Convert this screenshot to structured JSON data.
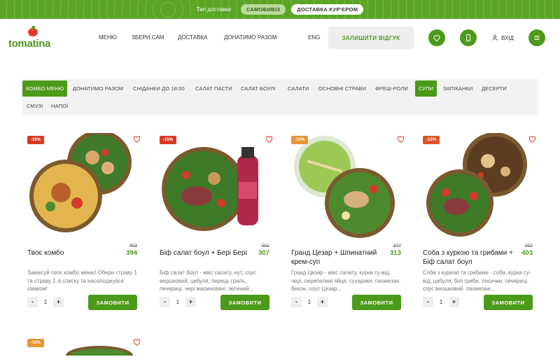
{
  "topbar": {
    "label": "Тип доставки:",
    "options": [
      "САМОВИВІЗ",
      "ДОСТАВКА КУР'ЄРОМ"
    ]
  },
  "logo": {
    "text": "tomatina"
  },
  "nav": {
    "items": [
      "МЕНЮ",
      "ЗБЕРИ САМ",
      "ДОСТАВКА",
      "ДОНАТИМО РАЗОМ"
    ],
    "lang": "ENG",
    "review": "ЗАЛИШИТИ ВІДГУК",
    "login": "ВХІД"
  },
  "categories": [
    "КОМБО МЕНЮ",
    "ДОНАТИМО РАЗОМ",
    "СНІДАНКИ ДО 18:00",
    "САЛАТ ПАСТИ",
    "САЛАТ БОУЛІ",
    "САЛАТИ",
    "ОСНОВНІ СТРАВИ",
    "ФРЕШ-РОЛИ",
    "СУПИ",
    "ЗАПІКАНКИ",
    "ДЕСЕРТИ",
    "СМУЗІ",
    "НАПОЇ"
  ],
  "selected_categories": [
    "КОМБО МЕНЮ",
    "СУПИ"
  ],
  "products": [
    {
      "discount": "-15%",
      "name": "Твоє комбо",
      "old_price": "463",
      "price": "394",
      "desc": "Заміксуй своє комбо меню! Обери страву 1 та страву 2 зі списку та насолоджуйся смаком!",
      "qty": "1"
    },
    {
      "discount": "-15%",
      "name": "Біф салат боул + Бері Бері",
      "old_price": "361",
      "price": "307",
      "desc": "Біф салат боул - мікс салату, нут, соус вершковий, цибуля, перець гриль, печериці. чері маоиновані. зелений...",
      "qty": "1"
    },
    {
      "discount": "-10%",
      "name": "Гранд Цезар + Шпинатний крем-суп",
      "old_price": "347",
      "price": "313",
      "desc": "Гранд Цезар - мікс салату, курка су-від, чері, перепелині яйця, сухарики, пaомезан. бекон. соус Цезар...",
      "qty": "1"
    },
    {
      "discount": "-12%",
      "name": "Соба з куркою та грибами + Біф салат боул",
      "old_price": "462",
      "price": "403",
      "desc": "Соба з куркою та грибами - соба, курка су-від, цибуля, білі гриби, лисички, печериці. соус веошковий. пaомезан...",
      "qty": "1"
    }
  ],
  "next_row_discount": "-10%",
  "buttons": {
    "minus": "-",
    "plus": "+",
    "order": "ЗАМОВИТИ"
  },
  "colors": {
    "brand": "#4c9a1a",
    "topbar": "#5aa524",
    "discount_red": "#d83a23",
    "discount_orange": "#e4953a"
  }
}
